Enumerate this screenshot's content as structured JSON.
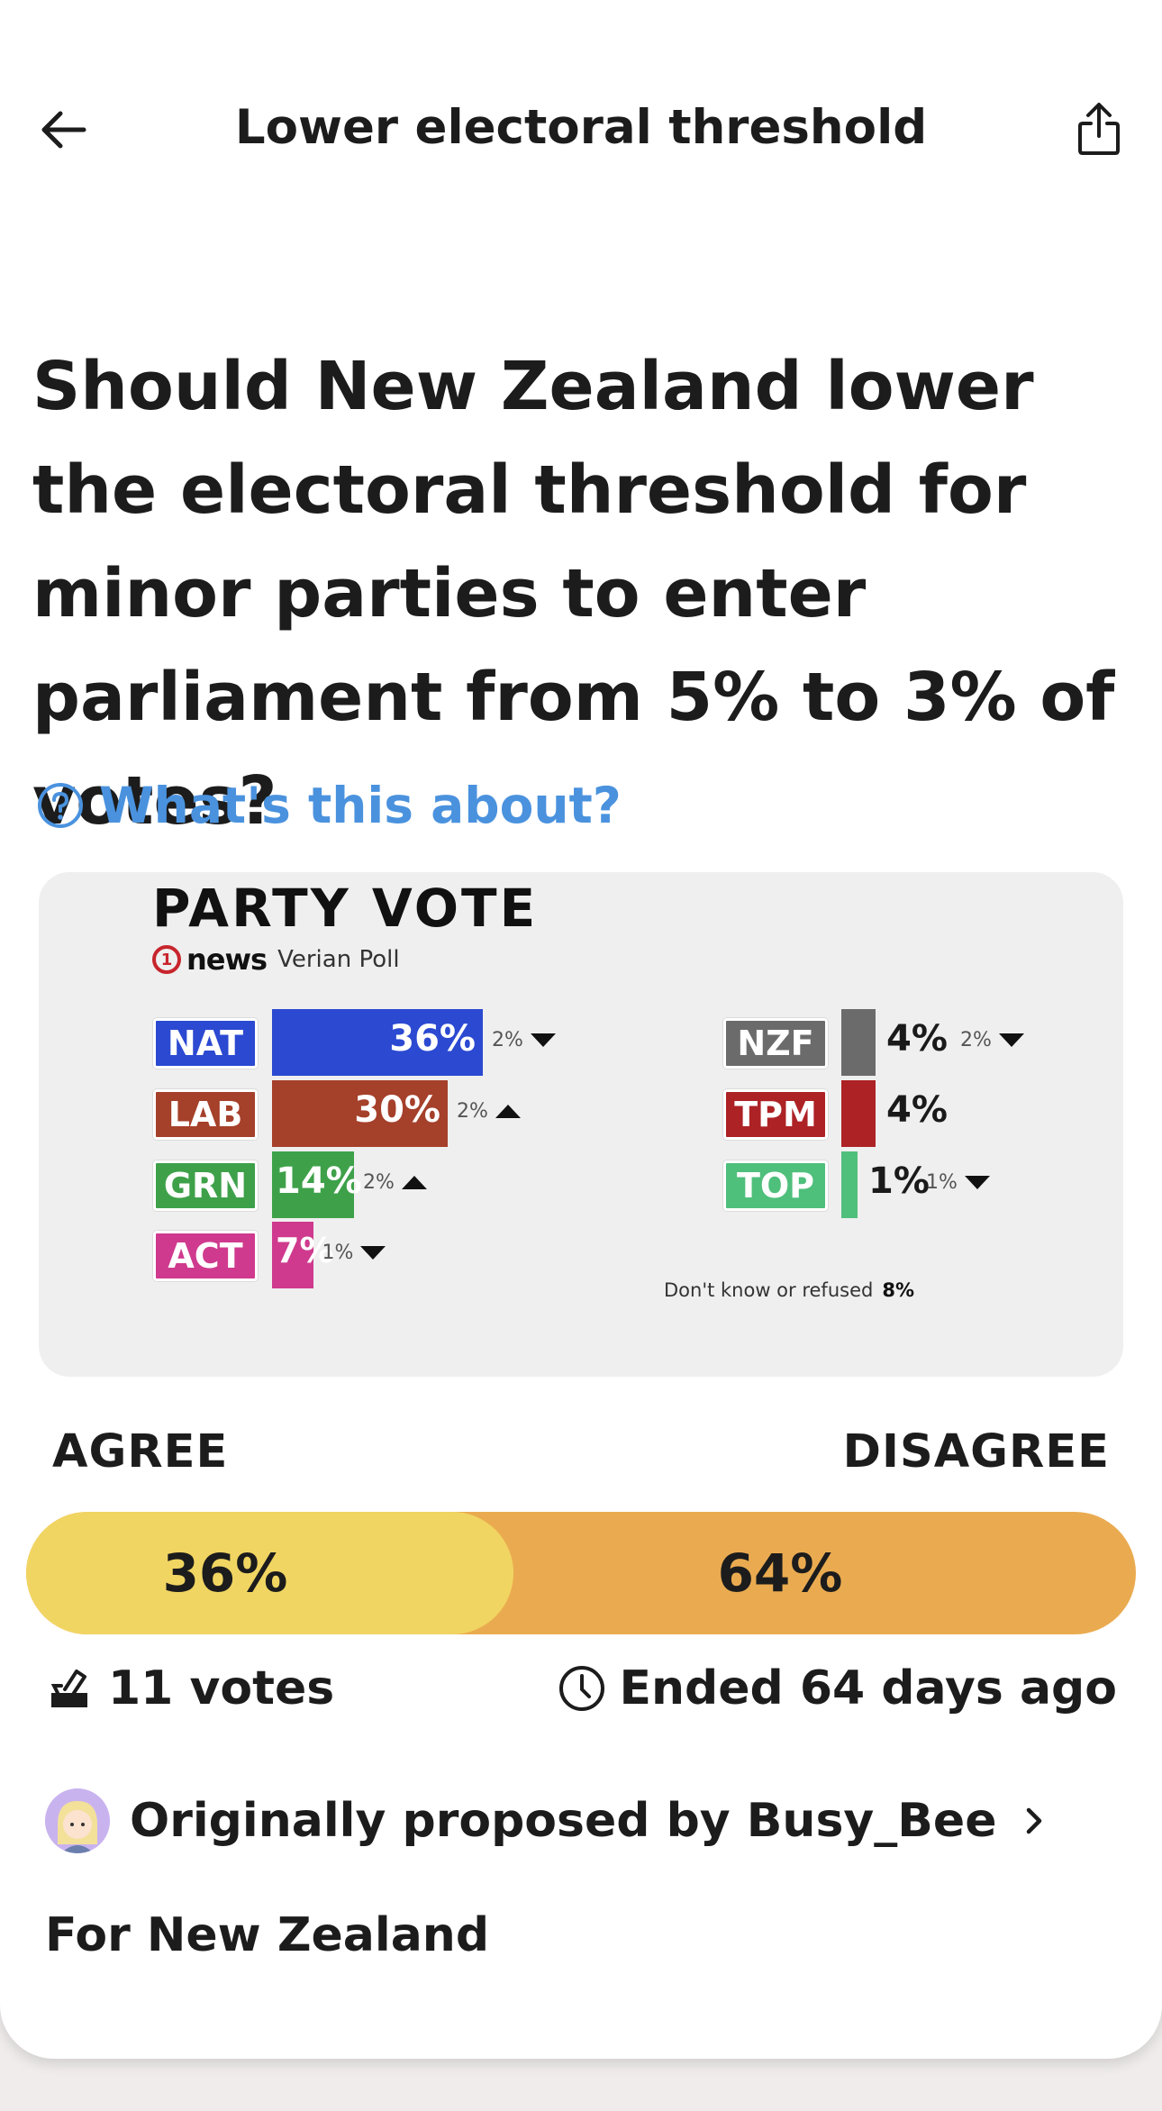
{
  "nav": {
    "title": "Lower electoral threshold",
    "back_icon": "arrow-left-icon",
    "share_icon": "share-icon"
  },
  "question": "Should New Zealand lower the electoral threshold for minor parties to enter parliament from 5% to 3% of votes?",
  "about_link": {
    "label": "What's this about?",
    "icon": "question-circle-icon",
    "color": "#4a92de"
  },
  "poll_image": {
    "title": "PARTY VOTE",
    "source_brand": "news",
    "source_logo_number": "1",
    "source_poll": "Verian Poll",
    "dont_know_label": "Don't know or refused",
    "dont_know_value": "8%",
    "chart_data": {
      "type": "bar",
      "title": "PARTY VOTE",
      "categories": [
        "NAT",
        "LAB",
        "GRN",
        "ACT",
        "NZF",
        "TPM",
        "TOP"
      ],
      "values": [
        36,
        30,
        14,
        7,
        4,
        4,
        1
      ],
      "value_labels": [
        "36%",
        "30%",
        "14%",
        "7%",
        "4%",
        "4%",
        "1%"
      ],
      "changes": [
        "2%",
        "2%",
        "2%",
        "1%",
        "2%",
        "",
        "1%"
      ],
      "change_direction": [
        "down",
        "up",
        "up",
        "down",
        "down",
        "",
        "down"
      ],
      "colors": [
        "#2b49d1",
        "#a5402a",
        "#3ea14a",
        "#cf3a8e",
        "#6b6b6b",
        "#ad2225",
        "#4fbf7c"
      ],
      "unit": "%"
    }
  },
  "results": {
    "agree_label": "AGREE",
    "disagree_label": "DISAGREE",
    "agree_percent": "36%",
    "disagree_percent": "64%",
    "agree_fraction": 0.36,
    "agree_color": "#f1d562",
    "disagree_color": "#eaab50"
  },
  "meta": {
    "votes": "11 votes",
    "votes_icon": "ballot-box-icon",
    "ended": "Ended 64 days ago",
    "ended_icon": "clock-icon"
  },
  "proposer": {
    "text": "Originally proposed by Busy_Bee",
    "avatar": "avatar-icon"
  },
  "region": "For New Zealand"
}
